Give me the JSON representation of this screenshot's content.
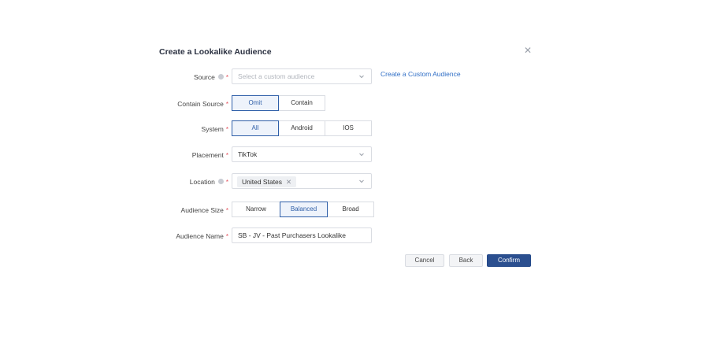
{
  "dialog": {
    "title": "Create a Lookalike Audience",
    "close_icon": "close-icon"
  },
  "form": {
    "source": {
      "label": "Source",
      "required": "*",
      "placeholder": "Select a custom audience",
      "link": "Create a Custom Audience"
    },
    "contain_source": {
      "label": "Contain Source",
      "required": "*",
      "options": [
        "Omit",
        "Contain"
      ],
      "selected": "Omit"
    },
    "system": {
      "label": "System",
      "required": "*",
      "options": [
        "All",
        "Android",
        "IOS"
      ],
      "selected": "All"
    },
    "placement": {
      "label": "Placement",
      "required": "*",
      "value": "TikTok"
    },
    "location": {
      "label": "Location",
      "required": "*",
      "tags": [
        "United States"
      ]
    },
    "audience_size": {
      "label": "Audience Size",
      "required": "*",
      "options": [
        "Narrow",
        "Balanced",
        "Broad"
      ],
      "selected": "Balanced"
    },
    "audience_name": {
      "label": "Audience Name",
      "required": "*",
      "value": "SB - JV - Past Purchasers Lookalike"
    }
  },
  "footer": {
    "cancel": "Cancel",
    "back": "Back",
    "confirm": "Confirm"
  },
  "colors": {
    "primary": "#2b4f8f",
    "link": "#2f6ec6",
    "required": "#e34d59"
  }
}
